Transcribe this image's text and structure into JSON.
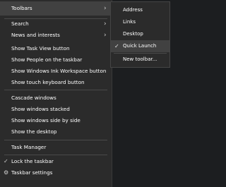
{
  "menu": {
    "toolbars": "Toolbars",
    "search": "Search",
    "news": "News and interests",
    "task_view": "Show Task View button",
    "people": "Show People on the taskbar",
    "ink": "Show Windows Ink Workspace button",
    "touch": "Show touch keyboard button",
    "cascade": "Cascade windows",
    "stacked": "Show windows stacked",
    "side": "Show windows side by side",
    "desktop": "Show the desktop",
    "task_manager": "Task Manager",
    "lock": "Lock the taskbar",
    "settings": "Taskbar settings"
  },
  "submenu": {
    "address": "Address",
    "links": "Links",
    "desktop": "Desktop",
    "quick_launch": "Quick Launch",
    "new_toolbar": "New toolbar..."
  },
  "icons": {
    "chevron": "chevron-right-icon",
    "check": "check-icon",
    "gear": "gear-icon"
  }
}
